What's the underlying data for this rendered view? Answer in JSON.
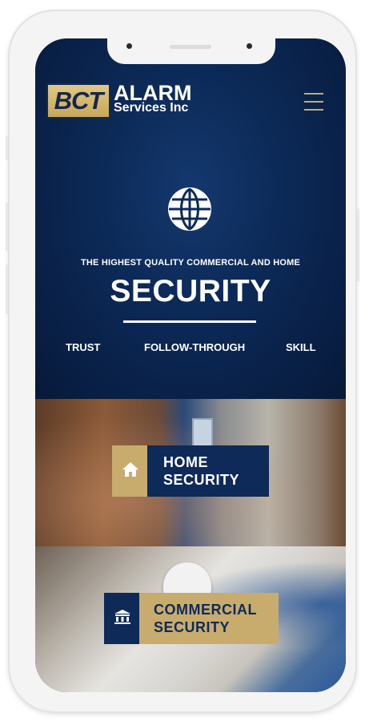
{
  "header": {
    "logo_mark": "BCT",
    "logo_name": "ALARM",
    "logo_sub": "Services Inc",
    "menu_icon": "hamburger-menu-icon"
  },
  "hero": {
    "icon": "globe-icon",
    "tagline": "THE HIGHEST QUALITY COMMERCIAL AND HOME",
    "title": "SECURITY",
    "values": [
      "TRUST",
      "FOLLOW-THROUGH",
      "SKILL"
    ]
  },
  "services": [
    {
      "icon": "home-icon",
      "line1": "HOME",
      "line2": "SECURITY"
    },
    {
      "icon": "building-icon",
      "line1": "COMMERCIAL",
      "line2": "SECURITY"
    }
  ],
  "colors": {
    "navy": "#0d2a58",
    "gold": "#c8ac6e",
    "white": "#ffffff"
  }
}
